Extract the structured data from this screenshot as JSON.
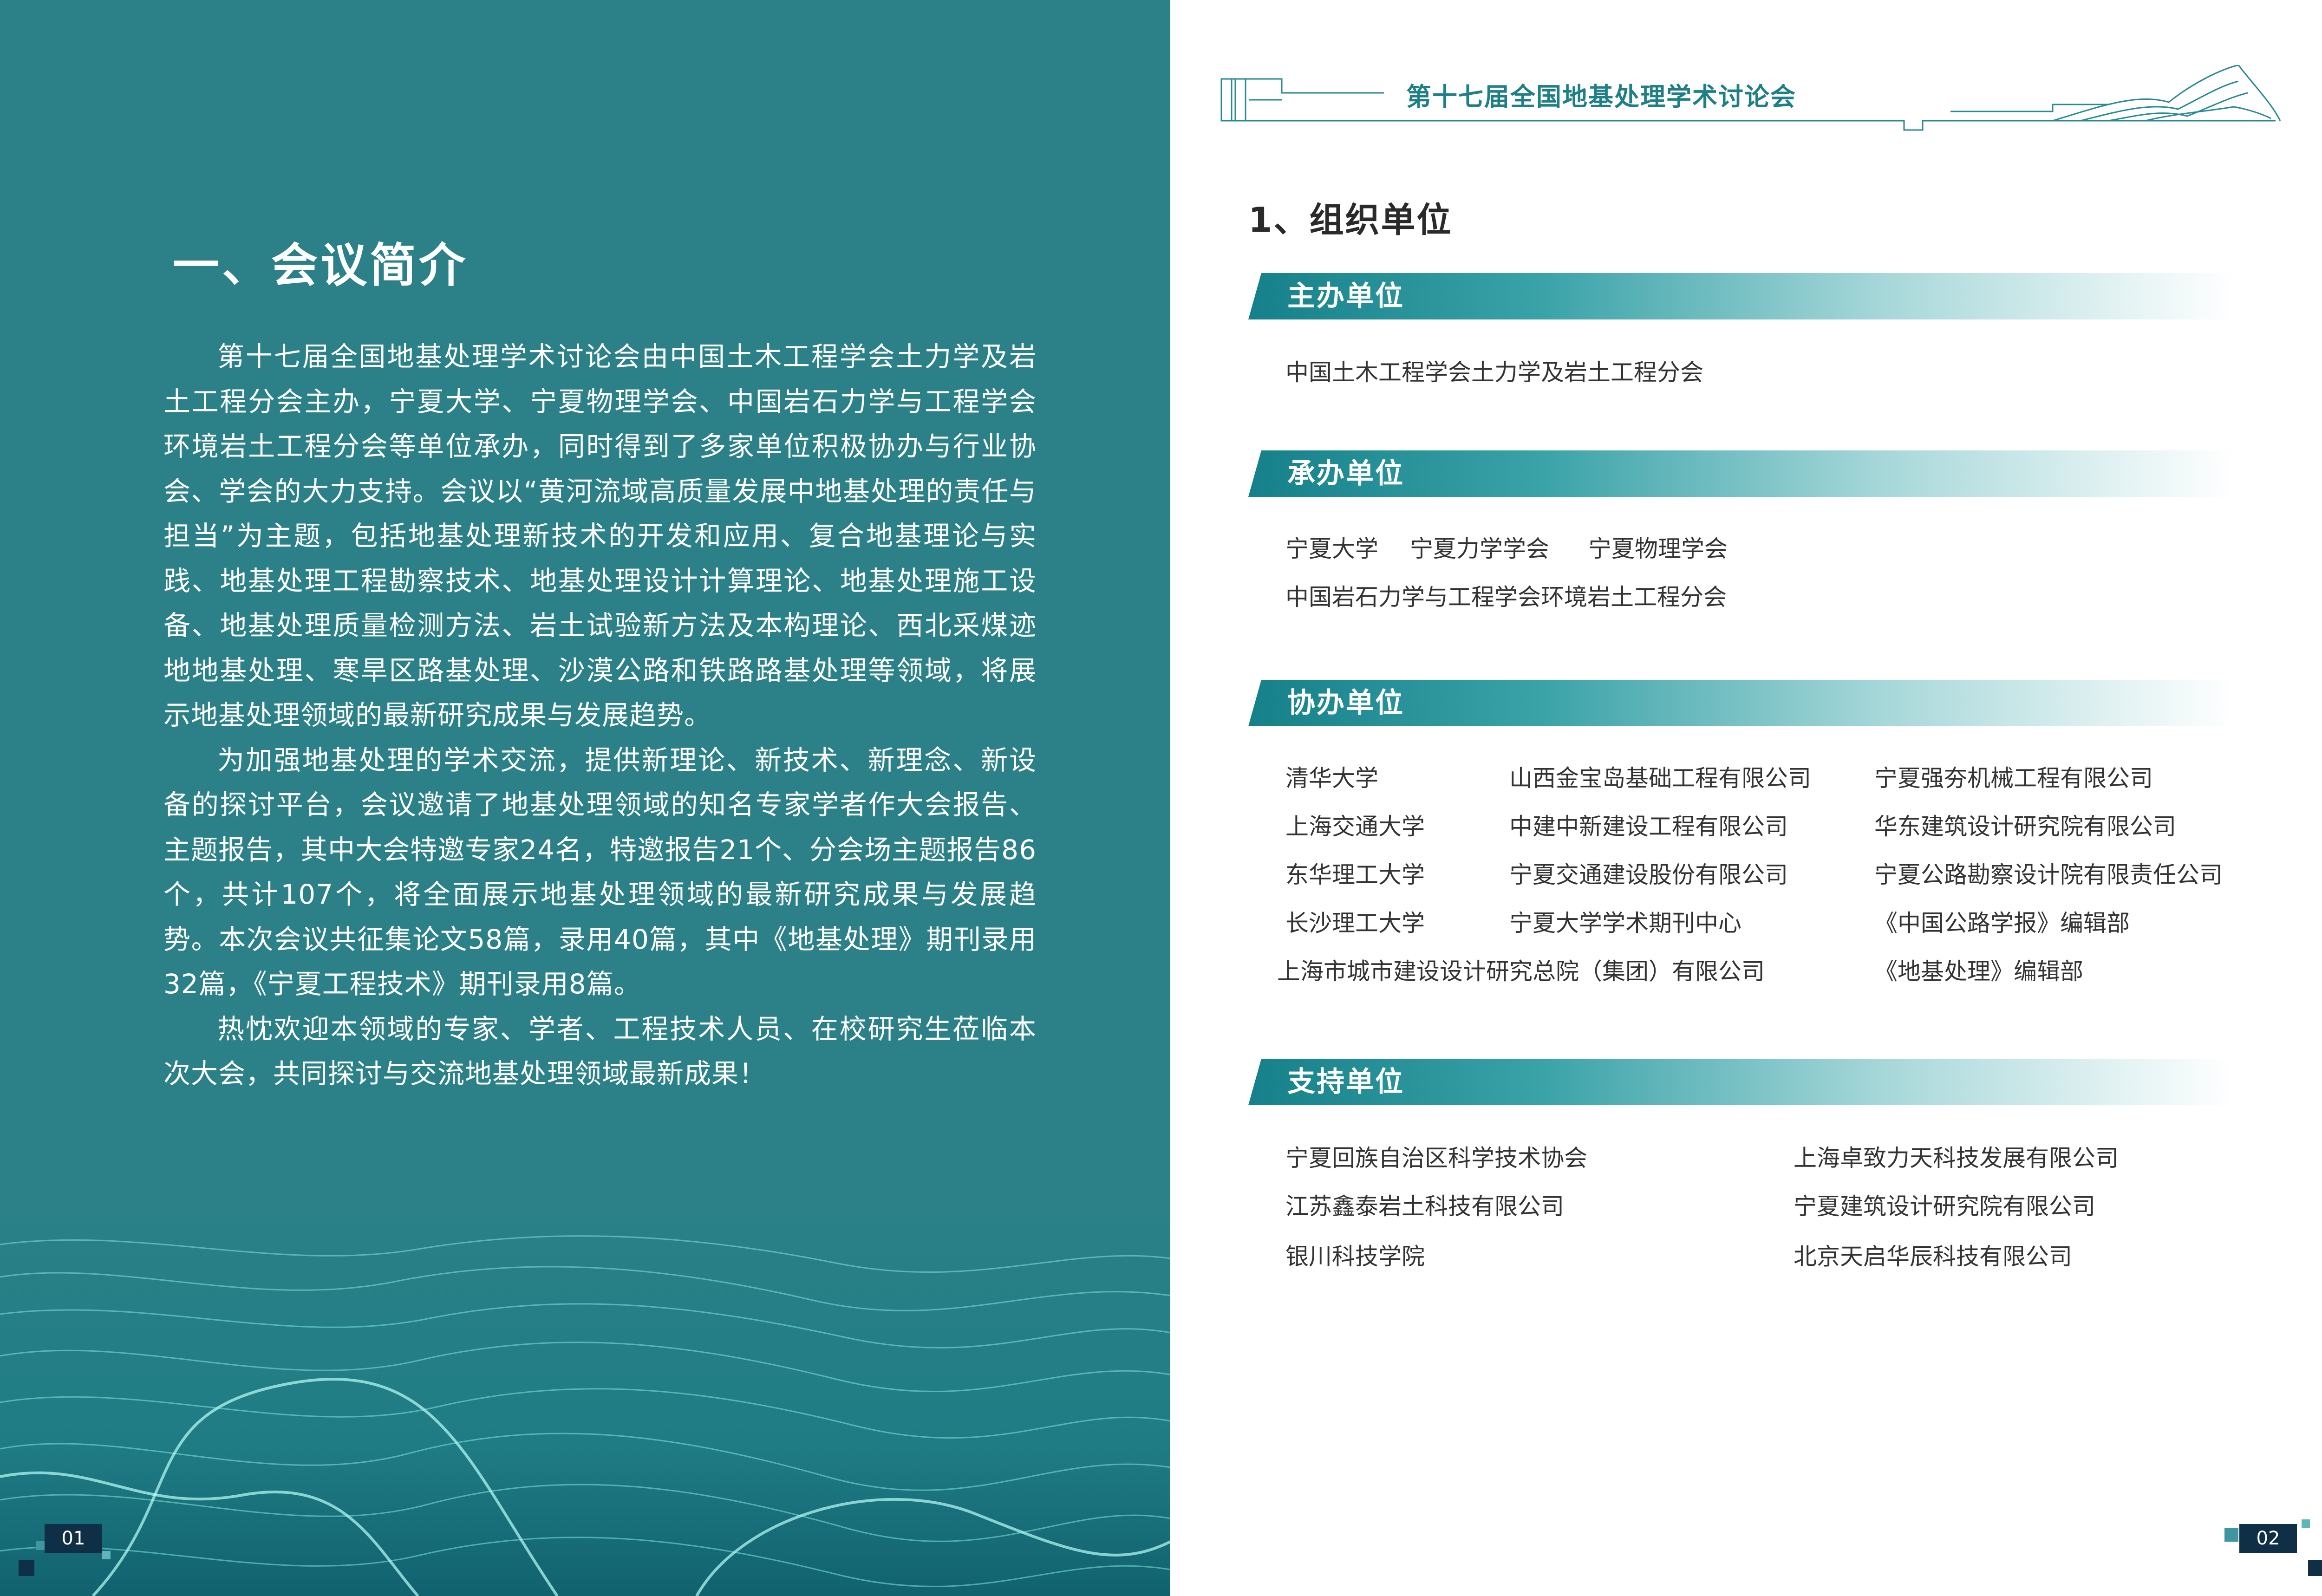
{
  "left_page": {
    "heading": "一、会议简介",
    "paragraphs": [
      "第十七届全国地基处理学术讨论会由中国土木工程学会土力学及岩土工程分会主办，宁夏大学、宁夏物理学会、中国岩石力学与工程学会环境岩土工程分会等单位承办，同时得到了多家单位积极协办与行业协会、学会的大力支持。会议以“黄河流域高质量发展中地基处理的责任与担当”为主题，包括地基处理新技术的开发和应用、复合地基理论与实践、地基处理工程勘察技术、地基处理设计计算理论、地基处理施工设备、地基处理质量检测方法、岩土试验新方法及本构理论、西北采煤迹地地基处理、寒旱区路基处理、沙漠公路和铁路路基处理等领域，将展示地基处理领域的最新研究成果与发展趋势。",
      "为加强地基处理的学术交流，提供新理论、新技术、新理念、新设备的探讨平台，会议邀请了地基处理领域的知名专家学者作大会报告、主题报告，其中大会特邀专家24名，特邀报告21个、分会场主题报告86个，共计107个，将全面展示地基处理领域的最新研究成果与发展趋势。本次会议共征集论文58篇，录用40篇，其中《地基处理》期刊录用32篇，《宁夏工程技术》期刊录用8篇。",
      "热忱欢迎本领域的专家、学者、工程技术人员、在校研究生莅临本次大会，共同探讨与交流地基处理领域最新成果！"
    ],
    "page_number": "01"
  },
  "right_page": {
    "header_title": "第十七届全国地基处理学术讨论会",
    "org_title": "1、组织单位",
    "sections": {
      "host": {
        "label": "主办单位",
        "items": [
          "中国土木工程学会土力学及岩土工程分会"
        ]
      },
      "organizer": {
        "label": "承办单位",
        "items": [
          "宁夏大学",
          "宁夏力学学会",
          "宁夏物理学会",
          "中国岩石力学与工程学会环境岩土工程分会"
        ]
      },
      "co_organizer": {
        "label": "协办单位",
        "items": [
          "清华大学",
          "山西金宝岛基础工程有限公司",
          "宁夏强夯机械工程有限公司",
          "上海交通大学",
          "中建中新建设工程有限公司",
          "华东建筑设计研究院有限公司",
          "东华理工大学",
          "宁夏交通建设股份有限公司",
          "宁夏公路勘察设计院有限责任公司",
          "长沙理工大学",
          "宁夏大学学术期刊中心",
          "《中国公路学报》编辑部",
          "上海市城市建设设计研究总院（集团）有限公司",
          "《地基处理》编辑部"
        ]
      },
      "support": {
        "label": "支持单位",
        "items": [
          "宁夏回族自治区科学技术协会",
          "上海卓致力天科技发展有限公司",
          "江苏鑫泰岩土科技有限公司",
          "宁夏建筑设计研究院有限公司",
          "银川科技学院",
          "北京天启华辰科技有限公司"
        ]
      }
    },
    "page_number": "02"
  },
  "colors": {
    "teal_bg": "#2b8187",
    "accent": "#1f7f86",
    "navy": "#0f2f46",
    "text": "#333333"
  }
}
